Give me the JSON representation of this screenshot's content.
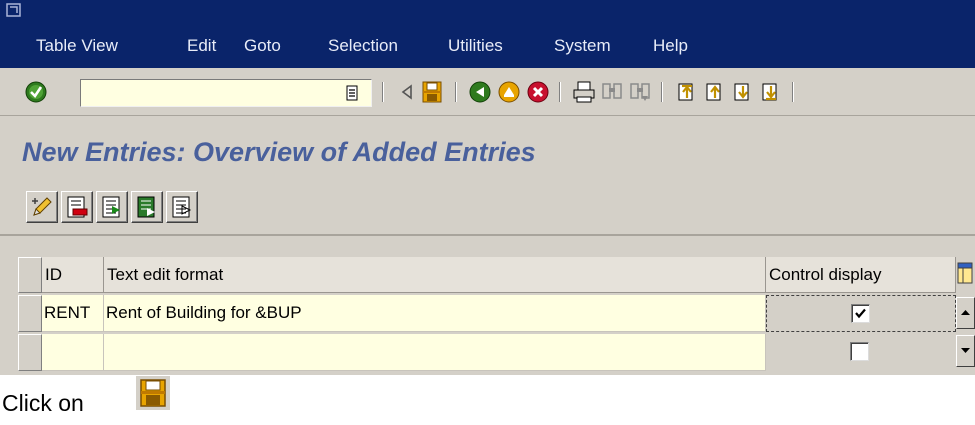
{
  "menu": {
    "items": [
      {
        "label": "Table View"
      },
      {
        "label": "Edit"
      },
      {
        "label": "Goto"
      },
      {
        "label": "Selection"
      },
      {
        "label": "Utilities"
      },
      {
        "label": "System"
      },
      {
        "label": "Help"
      }
    ]
  },
  "toolbar": {
    "command_field_value": "",
    "icons": [
      "enter-icon",
      "back-arrow-icon",
      "save-icon",
      "back-icon",
      "exit-icon",
      "cancel-icon",
      "print-icon",
      "find-icon",
      "find-next-icon",
      "first-page-icon",
      "previous-page-icon",
      "next-page-icon",
      "last-page-icon"
    ]
  },
  "page": {
    "title": "New Entries: Overview of Added Entries"
  },
  "app_toolbar": {
    "icons": [
      "change-display-icon",
      "delete-icon",
      "select-all-icon",
      "select-block-icon",
      "deselect-all-icon"
    ]
  },
  "table": {
    "columns": [
      {
        "label": "ID"
      },
      {
        "label": "Text edit format"
      },
      {
        "label": "Control display"
      }
    ],
    "rows": [
      {
        "id": "RENT",
        "text": "Rent of Building for &BUP",
        "control_display": true
      },
      {
        "id": "",
        "text": "",
        "control_display": false
      }
    ]
  },
  "caption": {
    "text": "Click on",
    "icon": "save-icon"
  },
  "colors": {
    "title_bar": "#0a246a",
    "background": "#d4d0c8",
    "page_title": "#49609c",
    "input_bg": "#ffffe1"
  }
}
